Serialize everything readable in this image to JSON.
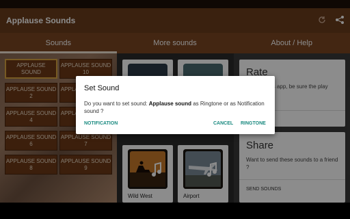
{
  "app": {
    "title": "Applause Sounds"
  },
  "tabs": [
    {
      "label": "Sounds"
    },
    {
      "label": "More sounds"
    },
    {
      "label": "About / Help"
    }
  ],
  "sounds": [
    "APPLAUSE SOUND",
    "APPLAUSE SOUND 10",
    "APPLAUSE SOUND 2",
    "APPLAUSE SOUND 3",
    "APPLAUSE SOUND 4",
    "APPLAUSE SOUND 5",
    "APPLAUSE SOUND 6",
    "APPLAUSE SOUND 7",
    "APPLAUSE SOUND 8",
    "APPLAUSE SOUND 9"
  ],
  "more_sounds": [
    {
      "label": ""
    },
    {
      "label": ""
    },
    {
      "label": "Wild West"
    },
    {
      "label": "Airport"
    }
  ],
  "about": {
    "rate_title": "Rate",
    "rate_text": "enjoyed this app, be sure the play store here.",
    "share_title": "Share",
    "share_text": "Want to send these sounds to a friend ?",
    "share_button": "SEND SOUNDS"
  },
  "dialog": {
    "title": "Set Sound",
    "msg_prefix": "Do you want to set sound: ",
    "sound_name": "Applause sound",
    "msg_suffix": " as Ringtone or as Notification sound ?",
    "notification_label": "NOTIFICATION",
    "cancel_label": "CANCEL",
    "ringtone_label": "RINGTONE"
  },
  "colors": {
    "appbar": "#6b3d1c",
    "accent": "#1a8a80",
    "sound_button": "#6d3a17",
    "selected_border": "#d9a441"
  }
}
